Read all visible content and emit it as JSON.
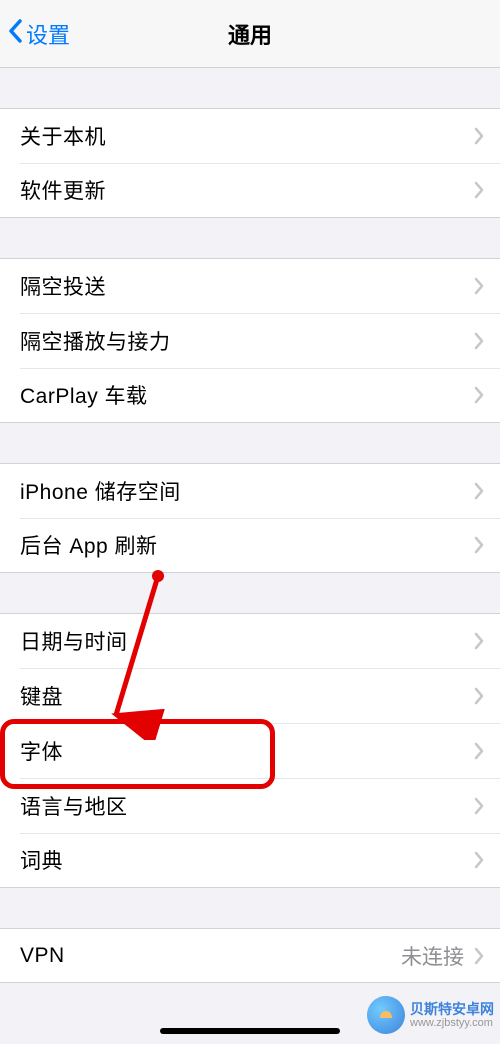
{
  "nav": {
    "back_label": "设置",
    "title": "通用"
  },
  "groups": [
    {
      "items": [
        {
          "key": "about",
          "label": "关于本机"
        },
        {
          "key": "software-update",
          "label": "软件更新"
        }
      ]
    },
    {
      "items": [
        {
          "key": "airdrop",
          "label": "隔空投送"
        },
        {
          "key": "airplay-handoff",
          "label": "隔空播放与接力"
        },
        {
          "key": "carplay",
          "label": "CarPlay 车载"
        }
      ]
    },
    {
      "items": [
        {
          "key": "iphone-storage",
          "label": "iPhone 储存空间"
        },
        {
          "key": "background-app-refresh",
          "label": "后台 App 刷新"
        }
      ]
    },
    {
      "items": [
        {
          "key": "date-time",
          "label": "日期与时间"
        },
        {
          "key": "keyboard",
          "label": "键盘"
        },
        {
          "key": "fonts",
          "label": "字体"
        },
        {
          "key": "language-region",
          "label": "语言与地区"
        },
        {
          "key": "dictionary",
          "label": "词典"
        }
      ]
    },
    {
      "items": [
        {
          "key": "vpn",
          "label": "VPN",
          "value": "未连接"
        }
      ]
    }
  ],
  "watermark": {
    "name": "贝斯特安卓网",
    "url": "www.zjbstyy.com"
  }
}
